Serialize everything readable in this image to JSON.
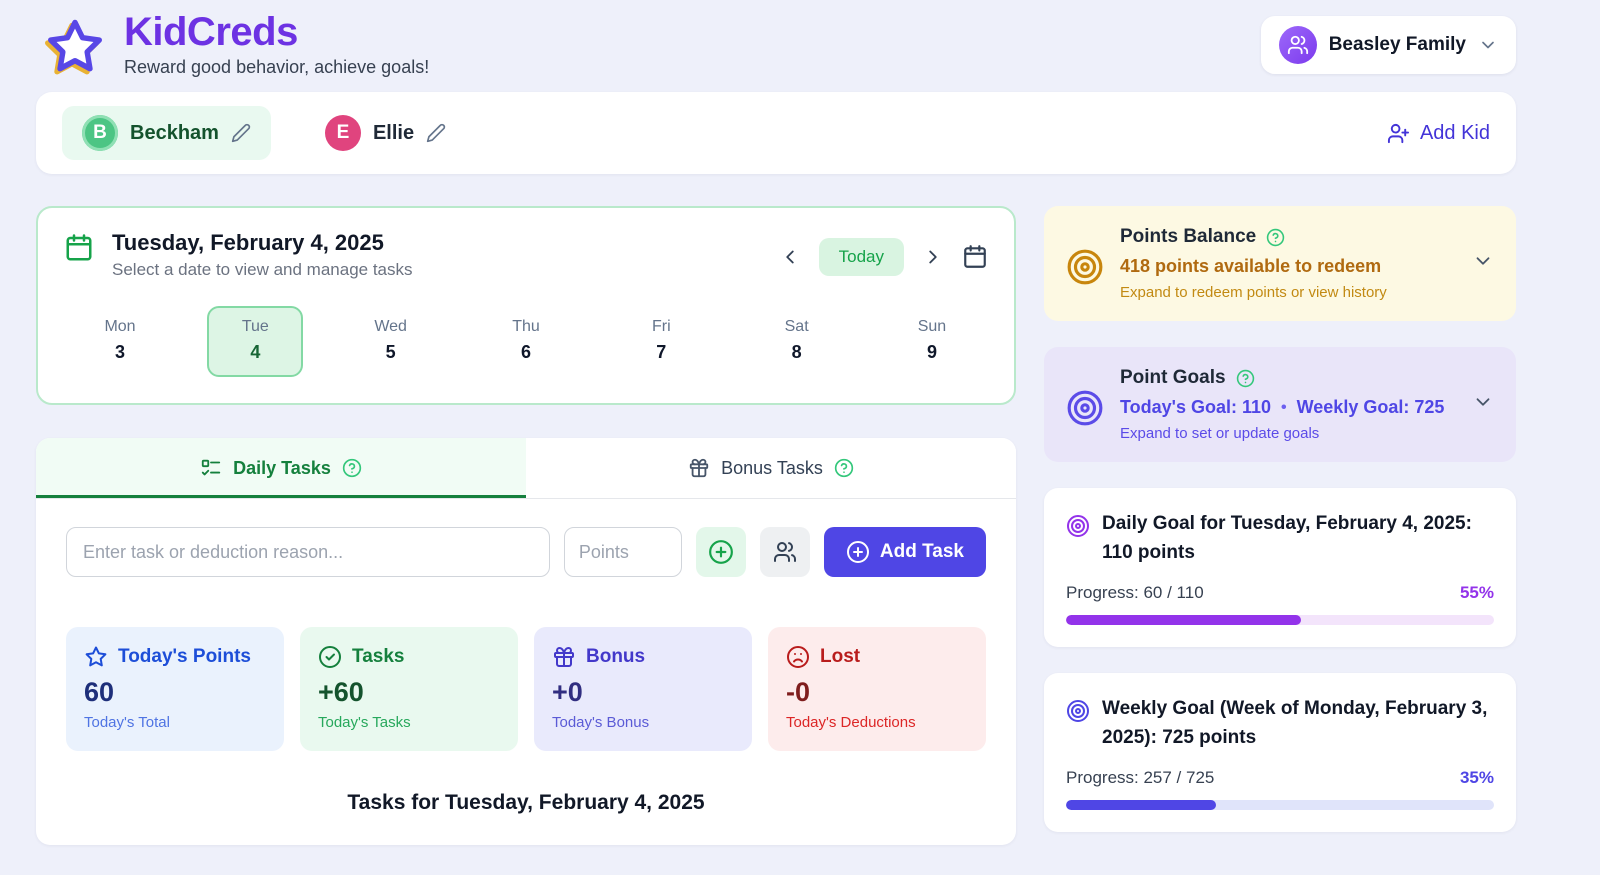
{
  "app": {
    "title": "KidCreds",
    "tagline": "Reward good behavior, achieve goals!"
  },
  "header": {
    "family_name": "Beasley Family"
  },
  "kids_bar": {
    "kids": [
      {
        "initial": "B",
        "name": "Beckham",
        "selected": true
      },
      {
        "initial": "E",
        "name": "Ellie",
        "selected": false
      }
    ],
    "add_kid_label": "Add Kid"
  },
  "date_picker": {
    "title": "Tuesday, February 4, 2025",
    "subtitle": "Select a date to view and manage tasks",
    "today_label": "Today",
    "days": [
      {
        "name": "Mon",
        "num": "3",
        "selected": false
      },
      {
        "name": "Tue",
        "num": "4",
        "selected": true
      },
      {
        "name": "Wed",
        "num": "5",
        "selected": false
      },
      {
        "name": "Thu",
        "num": "6",
        "selected": false
      },
      {
        "name": "Fri",
        "num": "7",
        "selected": false
      },
      {
        "name": "Sat",
        "num": "8",
        "selected": false
      },
      {
        "name": "Sun",
        "num": "9",
        "selected": false
      }
    ]
  },
  "tasks_panel": {
    "tabs": [
      {
        "label": "Daily Tasks",
        "active": true
      },
      {
        "label": "Bonus Tasks",
        "active": false
      }
    ],
    "form": {
      "task_placeholder": "Enter task or deduction reason...",
      "points_placeholder": "Points",
      "add_task_label": "Add Task"
    },
    "stats": [
      {
        "label": "Today's Points",
        "value": "60",
        "caption": "Today's Total"
      },
      {
        "label": "Tasks",
        "value": "+60",
        "caption": "Today's Tasks"
      },
      {
        "label": "Bonus",
        "value": "+0",
        "caption": "Today's Bonus"
      },
      {
        "label": "Lost",
        "value": "-0",
        "caption": "Today's Deductions"
      }
    ],
    "tasks_heading": "Tasks for Tuesday, February 4, 2025"
  },
  "sidebar": {
    "points_balance": {
      "title": "Points Balance",
      "summary": "418 points available to redeem",
      "hint": "Expand to redeem points or view history"
    },
    "point_goals": {
      "title": "Point Goals",
      "today_goal": "Today's Goal: 110",
      "separator": "•",
      "weekly_goal": "Weekly Goal: 725",
      "hint": "Expand to set or update goals"
    },
    "daily_goal": {
      "title": "Daily Goal for Tuesday, February 4, 2025: 110 points",
      "progress_label": "Progress: 60 / 110",
      "percent_label": "55%",
      "percent_width": "55%"
    },
    "weekly_goal": {
      "title": "Weekly Goal (Week of Monday, February 3, 2025): 725 points",
      "progress_label": "Progress: 257 / 725",
      "percent_label": "35%",
      "percent_width": "35%"
    }
  },
  "colors": {
    "brand_purple": "#6d32e3",
    "accent_indigo": "#4f46e5",
    "accent_violet": "#9333ea",
    "success_green": "#16a34a",
    "dark_green": "#15803d",
    "amber_text": "#b06a10",
    "danger_red": "#b91c1c",
    "info_blue": "#1d4ed8",
    "page_bg": "#eef0fa",
    "balance_bg": "#fdf9e3",
    "goals_bg": "#e9e5f9"
  },
  "icons": {
    "logo": "star-icon",
    "family": "users-icon",
    "edit": "pencil-icon",
    "add_kid": "user-plus-icon",
    "calendar": "calendar-icon",
    "prev": "chevron-left-icon",
    "next": "chevron-right-icon",
    "daily_tab": "checklist-icon",
    "bonus_tab": "gift-icon",
    "help": "help-circle-icon",
    "balance": "target-icon",
    "stat_points": "star-icon",
    "stat_tasks": "check-circle-icon",
    "stat_bonus": "gift-icon",
    "stat_lost": "frown-icon",
    "add": "plus-circle-icon",
    "expand": "chevron-down-icon"
  }
}
